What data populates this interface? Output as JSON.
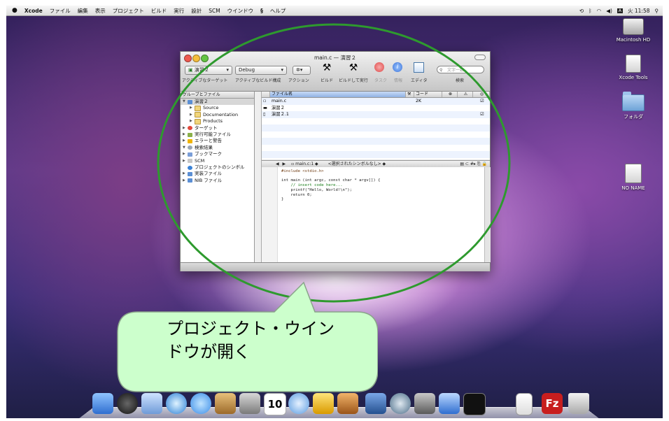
{
  "menubar": {
    "apple": "",
    "app": "Xcode",
    "items": [
      "ファイル",
      "編集",
      "表示",
      "プロジェクト",
      "ビルド",
      "実行",
      "設計",
      "SCM",
      "ウインドウ"
    ],
    "script_icon": "script-menu-icon",
    "help": "ヘルプ",
    "clock": "火 11:58"
  },
  "desktop": {
    "icons": [
      {
        "label": "Macintosh HD",
        "icon": "harddisk-icon"
      },
      {
        "label": "Xcode Tools",
        "icon": "disk-image-icon"
      },
      {
        "label": "フォルダ",
        "icon": "folder-icon"
      },
      {
        "label": "NO NAME",
        "icon": "usb-drive-icon"
      }
    ]
  },
  "window": {
    "title": "main.c — 演習２",
    "toolbar": {
      "target_select": "演習２",
      "config_select": "Debug",
      "action_select": "",
      "labels": {
        "active_target": "アクティブなターゲット",
        "active_config": "アクティブなビルド構成",
        "action": "アクション",
        "build": "ビルド",
        "build_and_run": "ビルドして実行",
        "tasks": "タスク",
        "info": "情報",
        "editor": "エディタ",
        "search": "検索"
      },
      "search_placeholder": "文字一致"
    },
    "sidebar": {
      "header": "グループとファイル",
      "items": [
        {
          "label": "演習２",
          "level": 0,
          "expanded": true,
          "icon": "project-icon"
        },
        {
          "label": "Source",
          "level": 1,
          "expanded": false,
          "icon": "folder-icon"
        },
        {
          "label": "Documentation",
          "level": 1,
          "expanded": false,
          "icon": "folder-icon"
        },
        {
          "label": "Products",
          "level": 1,
          "expanded": false,
          "icon": "folder-icon"
        },
        {
          "label": "ターゲット",
          "level": 0,
          "expanded": false,
          "icon": "target-icon"
        },
        {
          "label": "実行可能ファイル",
          "level": 0,
          "expanded": false,
          "icon": "executable-icon"
        },
        {
          "label": "エラーと警告",
          "level": 0,
          "expanded": false,
          "icon": "warning-icon"
        },
        {
          "label": "検索結果",
          "level": 0,
          "expanded": true,
          "icon": "search-icon"
        },
        {
          "label": "ブックマーク",
          "level": 0,
          "expanded": false,
          "icon": "bookmark-icon"
        },
        {
          "label": "SCM",
          "level": 0,
          "expanded": false,
          "icon": "scm-icon"
        },
        {
          "label": "プロジェクトのシンボル",
          "level": 0,
          "expanded": false,
          "icon": "symbols-icon"
        },
        {
          "label": "実装ファイル",
          "level": 0,
          "expanded": false,
          "icon": "implementation-icon"
        },
        {
          "label": "NIB ファイル",
          "level": 0,
          "expanded": false,
          "icon": "nib-icon"
        }
      ]
    },
    "file_table": {
      "columns": [
        "ファイル名",
        "コード"
      ],
      "rows": [
        {
          "name": "main.c",
          "code": "2K",
          "checked": true,
          "icon": "c-file-icon"
        },
        {
          "name": "演習２",
          "code": "",
          "checked": false,
          "icon": "app-icon"
        },
        {
          "name": "演習２.1",
          "code": "",
          "checked": true,
          "icon": "doc-icon"
        }
      ]
    },
    "editor_nav": {
      "file": "main.c:1",
      "symbol": "<選択されたシンボルなし>"
    },
    "code": [
      "#include <stdio.h>",
      "",
      "int main (int argc, const char * argv[]) {",
      "    // insert code here...",
      "    printf(\"Hello, World!\\n\");",
      "    return 0;",
      "}"
    ]
  },
  "annotation": {
    "text": "プロジェクト・ウインドウが開く",
    "line1": "プロジェクト・ウイン",
    "line2": "ドウが開く",
    "ellipse_color": "#2e9a2e",
    "callout_fill": "#ccffcc"
  },
  "dock": {
    "icons": [
      "finder-icon",
      "dashboard-icon",
      "mail-icon",
      "safari-icon",
      "ichat-icon",
      "address-book-icon",
      "iphoto-icon",
      "ical-icon",
      "itunes-icon",
      "imovie-icon",
      "garageband-icon",
      "spaces-icon",
      "time-machine-icon",
      "system-preferences-icon",
      "xcode-icon",
      "terminal-icon",
      "document-icon",
      "filezilla-icon",
      "trash-icon"
    ],
    "ical_date": "10"
  }
}
